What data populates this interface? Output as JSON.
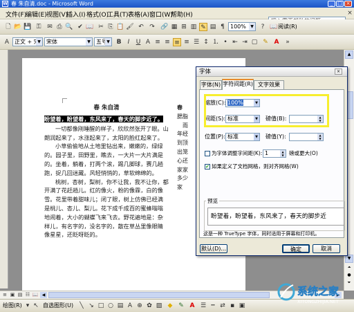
{
  "window": {
    "title": "春 朱自清.doc - Microsoft Word"
  },
  "menu": {
    "items": [
      "文件(F)",
      "编辑(E)",
      "视图(V)",
      "插入(I)",
      "格式(O)",
      "工具(T)",
      "表格(A)",
      "窗口(W)",
      "帮助(H)"
    ],
    "help_placeholder": "键入需要帮助的问题"
  },
  "toolbar": {
    "zoom": "100%",
    "reading_label": "阅读(R)"
  },
  "format_bar": {
    "style": "正文 + 宋体",
    "font": "宋体",
    "size": "五号"
  },
  "document": {
    "title": "春 朱自清",
    "selected_text": "盼望着，盼望着，东风来了，春天的脚步近了。",
    "paragraphs": [
      "一切都像刚睡醒的样子，欣欣然张开了眼。山朗润起来了，水涨起来了，太阳的脸红起来了。",
      "小草偷偷地从土地里钻出来，嫩嫩的，绿绿的。园子里，田野里，瞧去，一大片一大片满是的。坐着，躺着，打两个滚，踢几脚球，赛几趟跑，捉几回迷藏。风轻悄悄的，草软绵绵的。",
      "桃树，杏树，梨树，你不让我，我不让你，都开满了花赶趟儿。红的像火，粉的像霖，白的像雪。花里带着甜味儿；闭了眼，树上仿佛已经满是桃儿、杏儿、梨儿。花下成千成百的蜜蜂嗡嗡地闹着，大小的蝴蝶飞来飞去。野花遍地是：杂样儿，有名字的，没名字的，散在草丛里像眼睛像星星，还眨呀眨的。"
    ],
    "side_lines": [
      "春",
      "腮脂",
      "　雨",
      "年经",
      "到顶",
      "出笼",
      "心还",
      "家家",
      "多少",
      "家"
    ]
  },
  "dialog": {
    "title": "字体",
    "tabs": [
      "字体(N)",
      "字符间距(R)",
      "文字效果(X)"
    ],
    "scale_label": "缩放(C):",
    "scale_value": "100%",
    "spacing_label": "间距(S):",
    "spacing_value": "标准",
    "spacing_by_label": "磅值(B):",
    "position_label": "位置(P):",
    "position_value": "标准",
    "position_by_label": "磅值(Y):",
    "kerning_label": "为字体调整字间距(K):",
    "kerning_value": "1",
    "kerning_suffix": "磅或更大(O)",
    "grid_label": "如果定义了文档网格，则对齐网格(W)",
    "preview_label": "预览",
    "preview_text": "盼望着，盼望着，东风来了，春天的脚步近",
    "note": "这是一种 TrueType 字体，同时适用于屏幕和打印机。",
    "default_button": "默认(D)...",
    "ok_button": "确定",
    "cancel_button": "取消"
  },
  "drawbar": {
    "draw_label": "绘图(R)",
    "autoshape_label": "自选图形(U)"
  },
  "watermark": {
    "brand": "系统之家",
    "url": "XITONGZHIJIA.NET"
  },
  "colors": {
    "accent_yellow": "#f7ee2e",
    "title_blue": "#1c55c7",
    "tab_orange": "#e68b2c"
  }
}
